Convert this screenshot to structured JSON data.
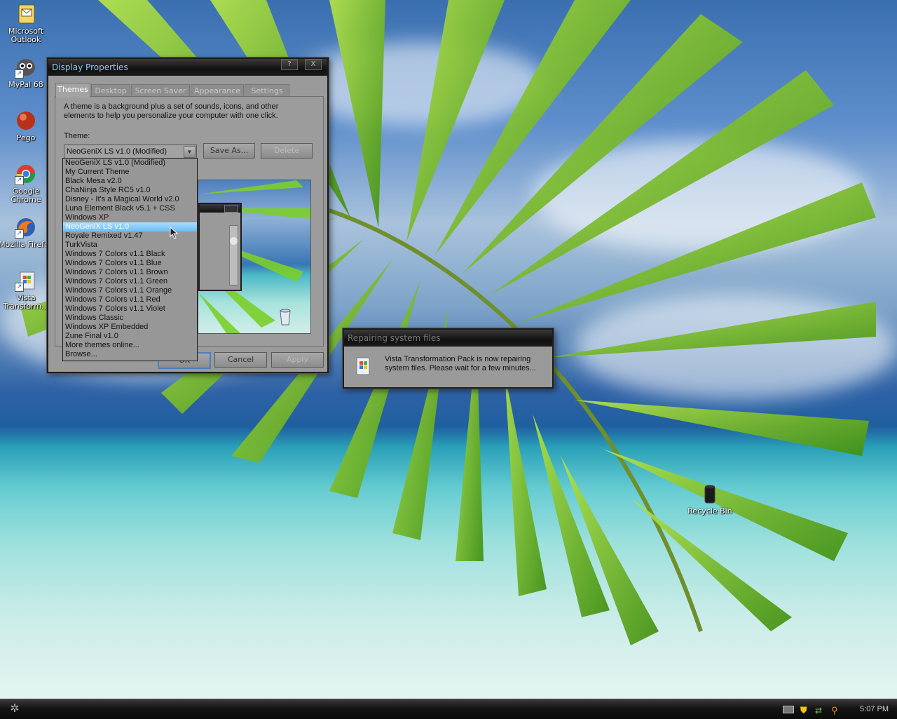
{
  "desktop": {
    "icons": [
      {
        "label": "Microsoft Outlook",
        "icon": "outlook-icon"
      },
      {
        "label": "MyPal 68",
        "icon": "mypal-icon"
      },
      {
        "label": "Pego",
        "icon": "pego-icon"
      },
      {
        "label": "Google Chrome",
        "icon": "chrome-icon"
      },
      {
        "label": "Mozilla Firefox",
        "icon": "firefox-icon"
      },
      {
        "label": "Vista Transform...",
        "icon": "vista-transform-icon"
      },
      {
        "label": "Recycle Bin",
        "icon": "recycle-bin-icon"
      }
    ]
  },
  "display_properties": {
    "title": "Display Properties",
    "title_buttons": {
      "help": "?",
      "close": "X"
    },
    "tabs": [
      "Themes",
      "Desktop",
      "Screen Saver",
      "Appearance",
      "Settings"
    ],
    "active_tab": "Themes",
    "description": "A theme is a background plus a set of sounds, icons, and other elements to help you personalize your computer with one click.",
    "theme_label": "Theme:",
    "theme_selected": "NeoGeniX LS v1.0 (Modified)",
    "save_as": "Save As...",
    "delete": "Delete",
    "ok": "OK",
    "cancel": "Cancel",
    "apply": "Apply",
    "theme_options": [
      "NeoGeniX LS v1.0 (Modified)",
      "My Current Theme",
      "Black Mesa v2.0",
      "ChaNinja Style RC5 v1.0",
      "Disney - It's a Magical World v2.0",
      "Luna Element Black v5.1 + CSS",
      "Windows XP",
      "NeoGeniX LS v1.0",
      "Royale Remixed v1.47",
      "TurkVista",
      "Windows 7 Colors v1.1 Black",
      "Windows 7 Colors v1.1 Blue",
      "Windows 7 Colors v1.1 Brown",
      "Windows 7 Colors v1.1 Green",
      "Windows 7 Colors v1.1 Orange",
      "Windows 7 Colors v1.1 Red",
      "Windows 7 Colors v1.1 Violet",
      "Windows Classic",
      "Windows XP Embedded",
      "Zune Final v1.0",
      "More themes online...",
      "Browse..."
    ],
    "highlighted_option_index": 7
  },
  "repair_dialog": {
    "title": "Repairing system files",
    "message_line1": "Vista Transformation Pack is now repairing",
    "message_line2": "system files. Please wait for a few minutes..."
  },
  "taskbar": {
    "clock": "5:07 PM",
    "tray_icons": [
      "keyboard-icon",
      "shield-icon",
      "network-icon",
      "search-icon"
    ]
  },
  "colors": {
    "title_text": "#8fc6ff",
    "selection": "#6dbcf5",
    "window_body": "#9a9a9a"
  }
}
